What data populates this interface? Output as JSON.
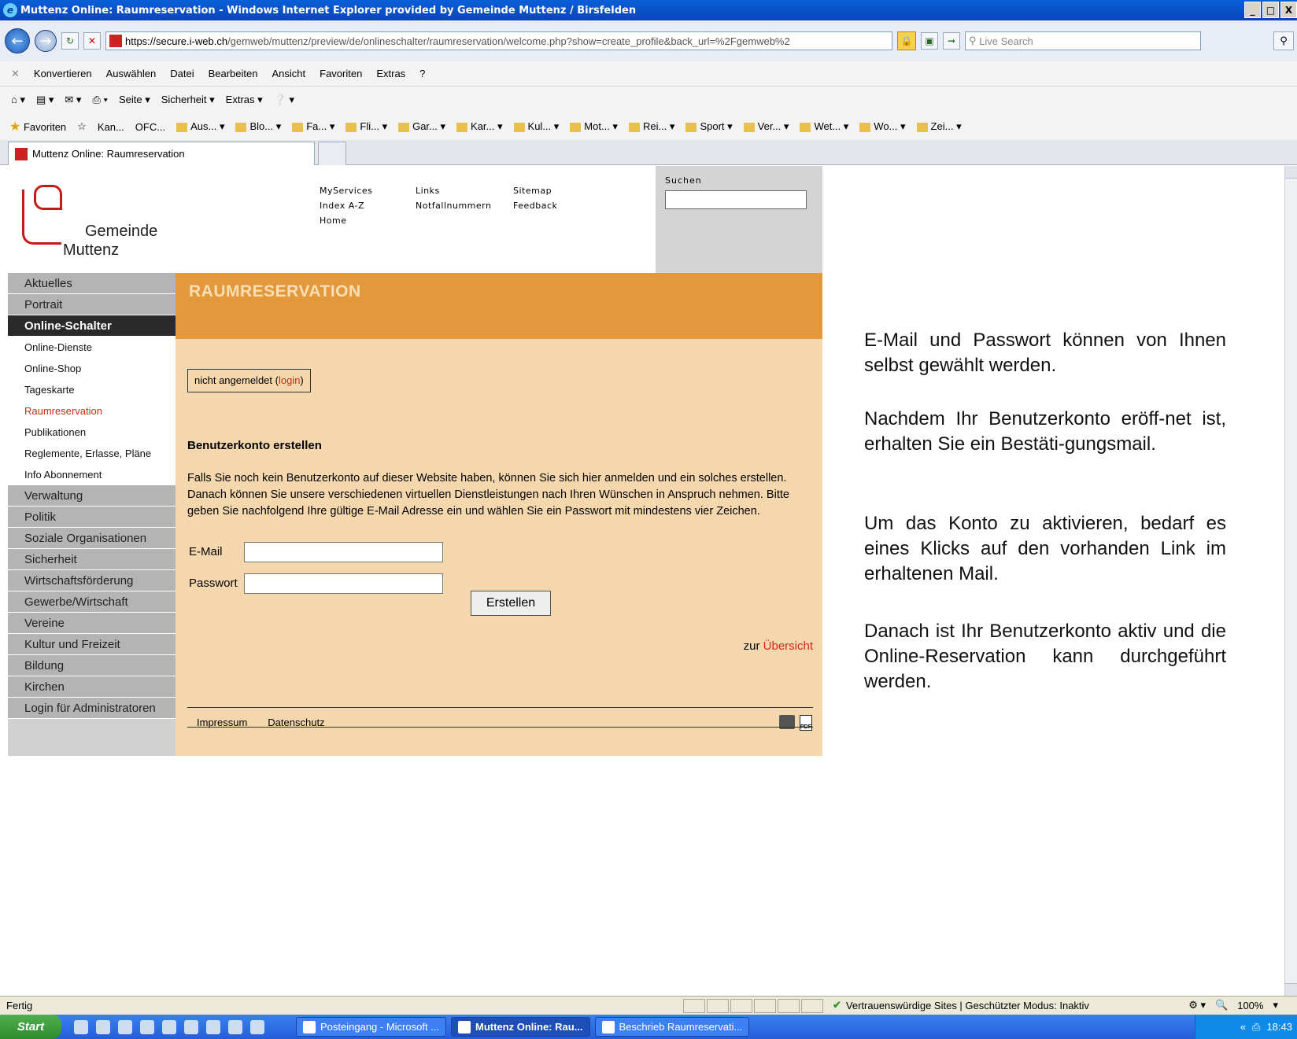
{
  "window": {
    "title": "Muttenz Online: Raumreservation - Windows Internet Explorer provided by Gemeinde Muttenz / Birsfelden",
    "buttons": [
      "_",
      "□",
      "X"
    ]
  },
  "address": {
    "url_scheme_host": "https://secure.i-web.ch",
    "url_path": "/gemweb/muttenz/preview/de/onlineschalter/raumreservation/welcome.php?show=create_profile&back_url=%2Fgemweb%2",
    "search_placeholder": "Live Search"
  },
  "menubar": {
    "items": [
      "Konvertieren",
      "Auswählen",
      "Datei",
      "Bearbeiten",
      "Ansicht",
      "Favoriten",
      "Extras",
      "?"
    ]
  },
  "commandbar": {
    "items": [
      "Seite",
      "Sicherheit",
      "Extras"
    ]
  },
  "favorites": {
    "label": "Favoriten",
    "items": [
      "Kan...",
      "OFC...",
      "Aus...",
      "Blo...",
      "Fa...",
      "Fli...",
      "Gar...",
      "Kar...",
      "Kul...",
      "Mot...",
      "Rei...",
      "Sport",
      "Ver...",
      "Wet...",
      "Wo...",
      "Zei..."
    ]
  },
  "tab": {
    "label": "Muttenz Online: Raumreservation"
  },
  "site": {
    "logo_line1": "Gemeinde",
    "logo_line2": "Muttenz",
    "topnav": {
      "col1": [
        "MyServices",
        "Index A-Z",
        "Home"
      ],
      "col2": [
        "Links",
        "Notfallnummern"
      ],
      "col3": [
        "Sitemap",
        "Feedback"
      ]
    },
    "search_label": "Suchen"
  },
  "sidebar": {
    "top": [
      "Aktuelles",
      "Portrait"
    ],
    "active": "Online-Schalter",
    "sub": [
      "Online-Dienste",
      "Online-Shop",
      "Tageskarte",
      "Raumreservation",
      "Publikationen",
      "Reglemente, Erlasse, Pläne",
      "Info Abonnement"
    ],
    "current_sub_index": 3,
    "bottom": [
      "Verwaltung",
      "Politik",
      "Soziale Organisationen",
      "Sicherheit",
      "Wirtschaftsförderung",
      "Gewerbe/Wirtschaft",
      "Vereine",
      "Kultur und Freizeit",
      "Bildung",
      "Kirchen",
      "Login für Administratoren"
    ]
  },
  "main": {
    "title": "RAUMRESERVATION",
    "login_status": "nicht angemeldet (",
    "login_link": "login",
    "login_close": ")",
    "section_title": "Benutzerkonto erstellen",
    "intro": "Falls Sie noch kein Benutzerkonto auf dieser Website haben, können Sie sich hier anmelden und ein solches erstellen. Danach können Sie unsere verschiedenen virtuellen Dienstleistungen nach Ihren Wünschen in Anspruch nehmen. Bitte geben Sie nachfolgend Ihre gültige E-Mail Adresse ein und wählen Sie ein Passwort mit mindestens vier Zeichen.",
    "email_label": "E-Mail",
    "email_value": "",
    "password_label": "Passwort",
    "password_value": "",
    "create_button": "Erstellen",
    "overview_prefix": "zur ",
    "overview_link": "Übersicht",
    "footer": [
      "Impressum",
      "Datenschutz"
    ]
  },
  "notes": [
    "E-Mail und Passwort können von Ihnen selbst gewählt werden.",
    "Nachdem Ihr Benutzerkonto eröff-net ist, erhalten Sie ein Bestäti-gungsmail.",
    "Um das Konto zu aktivieren, bedarf es eines Klicks auf den vorhanden Link im erhaltenen Mail.",
    "Danach ist Ihr Benutzerkonto aktiv und die Online-Reservation kann durchgeführt werden."
  ],
  "statusbar": {
    "left": "Fertig",
    "trust": "Vertrauenswürdige Sites | Geschützter Modus: Inaktiv",
    "zoom": "100%"
  },
  "taskbar": {
    "start": "Start",
    "tasks": [
      "Posteingang - Microsoft ...",
      "Muttenz Online: Rau...",
      "Beschrieb Raumreservati..."
    ],
    "active_task_index": 1,
    "clock": "18:43"
  },
  "colors": {
    "accent_orange": "#e2983b",
    "content_bg": "#f5d7ae",
    "link_red": "#d0281a",
    "sidebar_grey": "#b4b4b4",
    "sidebar_active": "#2a2a2a"
  }
}
